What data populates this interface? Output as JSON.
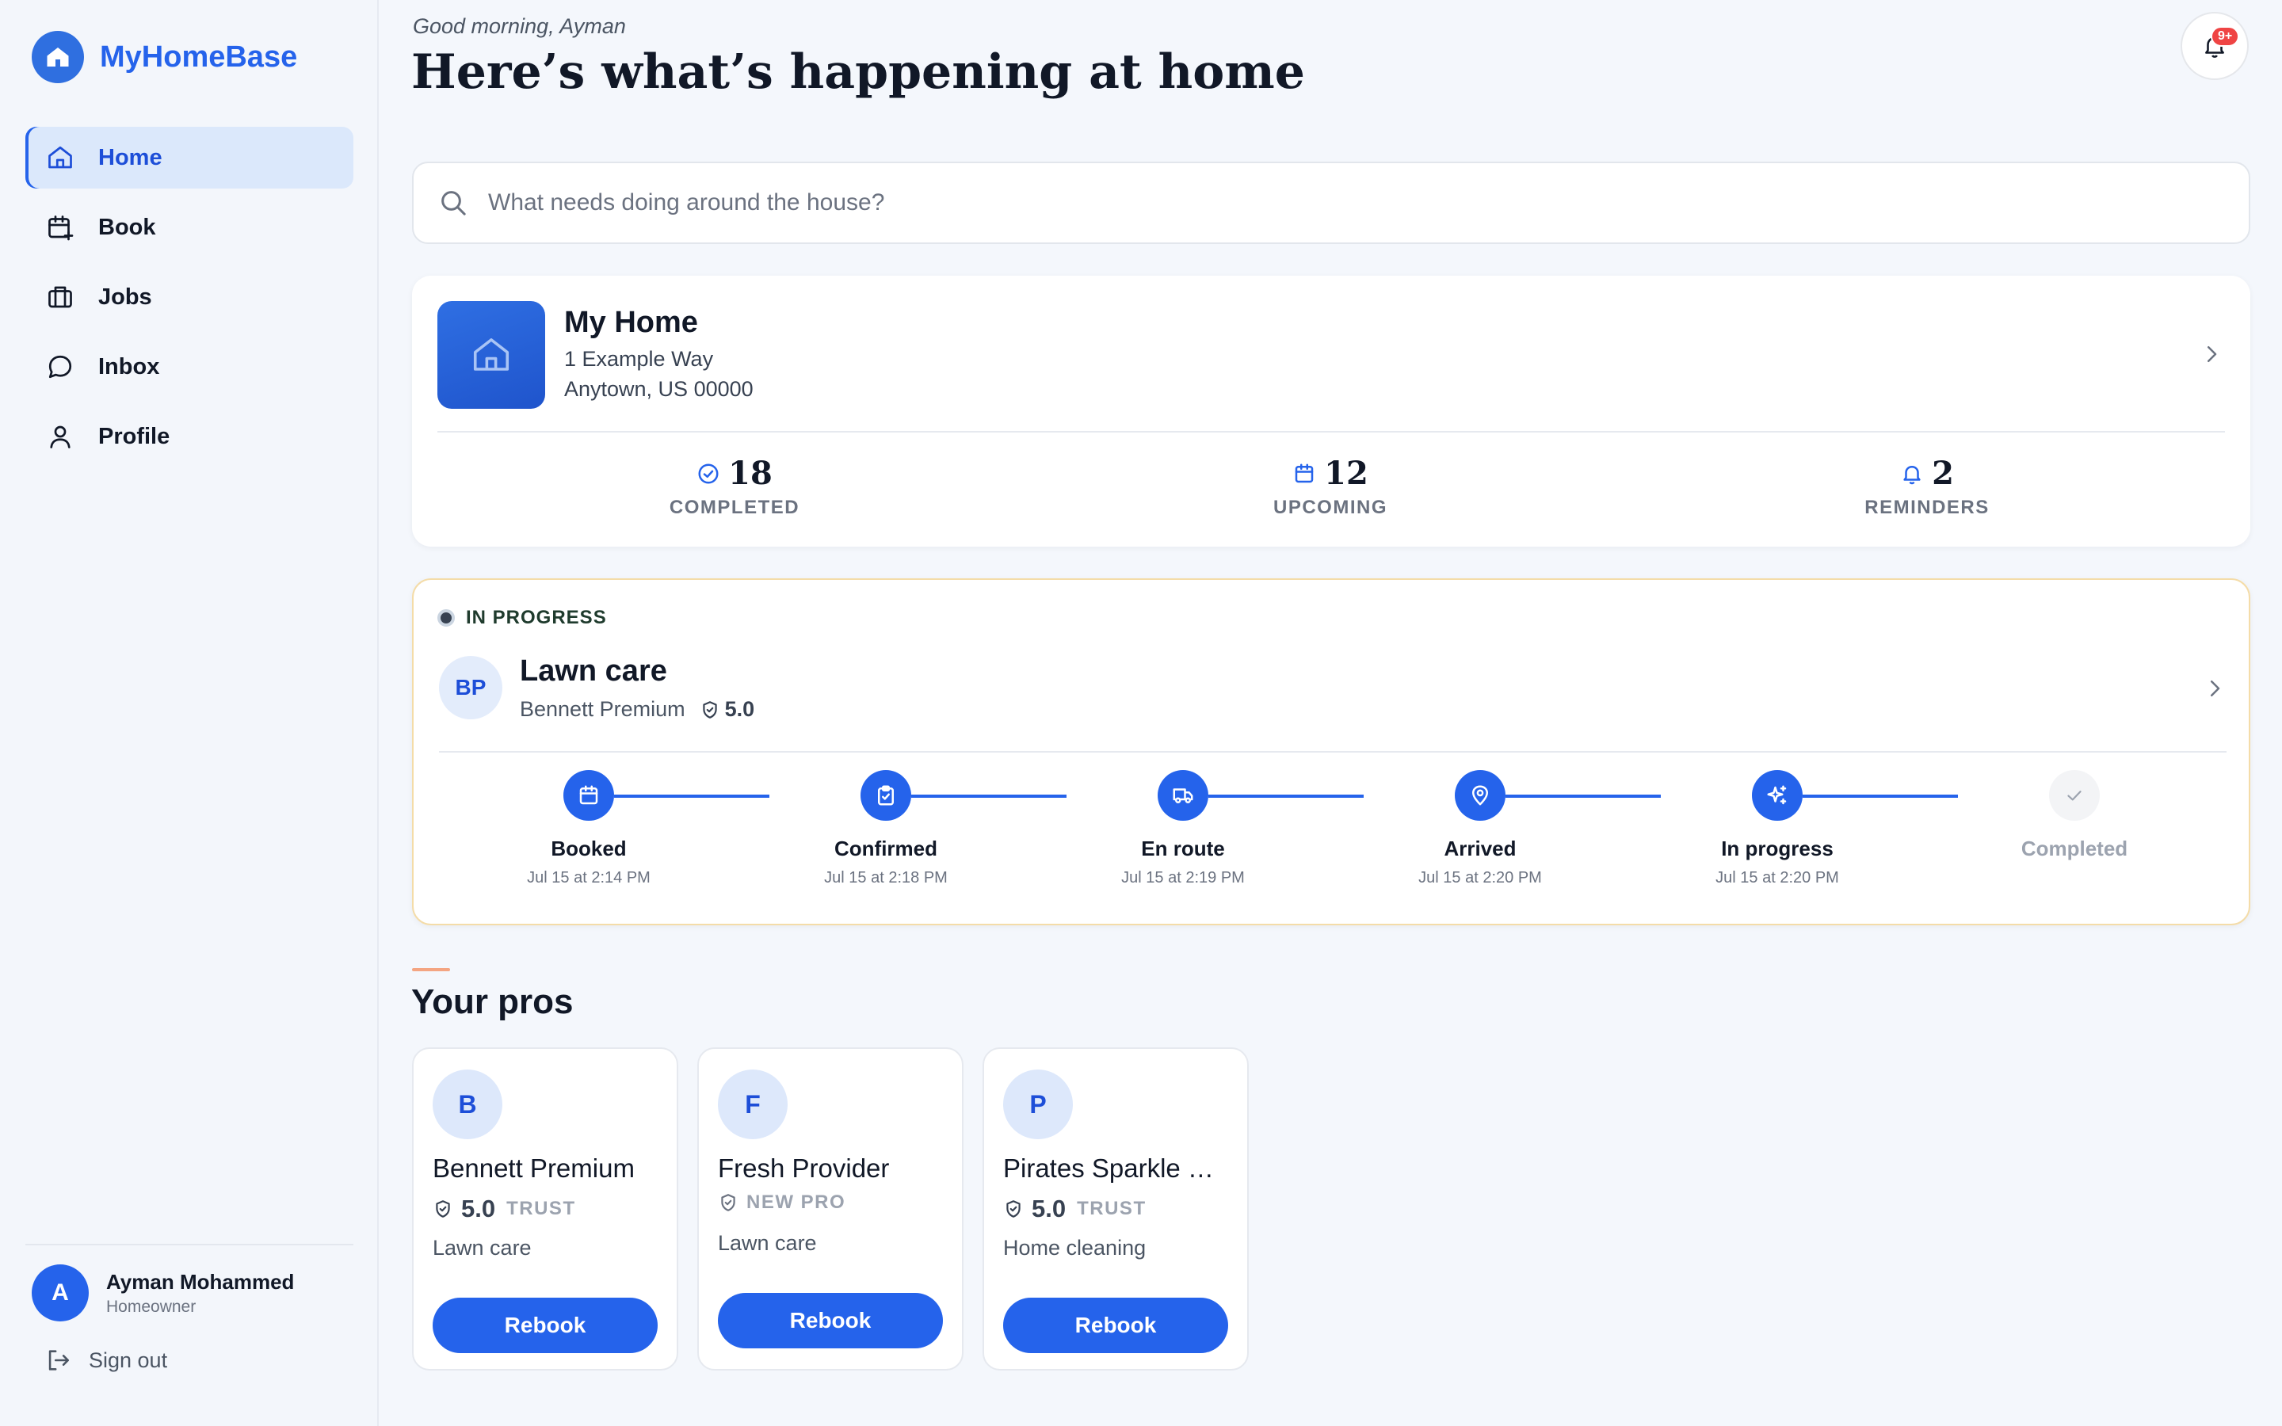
{
  "app": {
    "name": "MyHomeBase"
  },
  "nav": {
    "items": [
      {
        "label": "Home",
        "icon": "home-icon",
        "active": true
      },
      {
        "label": "Book",
        "icon": "calendar-plus-icon"
      },
      {
        "label": "Jobs",
        "icon": "briefcase-icon"
      },
      {
        "label": "Inbox",
        "icon": "chat-bubble-icon"
      },
      {
        "label": "Profile",
        "icon": "user-icon"
      }
    ]
  },
  "user": {
    "initial": "A",
    "name": "Ayman Mohammed",
    "role": "Homeowner",
    "signout_label": "Sign out"
  },
  "header": {
    "greeting": "Good morning, Ayman",
    "title": "Here’s what’s happening at home",
    "notifications_badge": "9+"
  },
  "search": {
    "placeholder": "What needs doing around the house?",
    "value": ""
  },
  "home": {
    "name": "My Home",
    "address_line1": "1 Example Way",
    "address_line2": "Anytown, US 00000",
    "stats": [
      {
        "value": "18",
        "label": "COMPLETED",
        "icon": "check-circle-icon"
      },
      {
        "value": "12",
        "label": "UPCOMING",
        "icon": "calendar-icon"
      },
      {
        "value": "2",
        "label": "REMINDERS",
        "icon": "bell-icon"
      }
    ]
  },
  "job": {
    "status": "IN PROGRESS",
    "initials": "BP",
    "title": "Lawn care",
    "provider": "Bennett Premium",
    "rating": "5.0",
    "steps": [
      {
        "label": "Booked",
        "time": "Jul 15 at 2:14 PM",
        "icon": "calendar-icon",
        "done": true
      },
      {
        "label": "Confirmed",
        "time": "Jul 15 at 2:18 PM",
        "icon": "clipboard-check-icon",
        "done": true
      },
      {
        "label": "En route",
        "time": "Jul 15 at 2:19 PM",
        "icon": "truck-icon",
        "done": true
      },
      {
        "label": "Arrived",
        "time": "Jul 15 at 2:20 PM",
        "icon": "map-pin-icon",
        "done": true
      },
      {
        "label": "In progress",
        "time": "Jul 15 at 2:20 PM",
        "icon": "sparkles-icon",
        "done": true
      },
      {
        "label": "Completed",
        "time": "",
        "icon": "check-icon",
        "done": false
      }
    ]
  },
  "pros": {
    "title": "Your pros",
    "items": [
      {
        "initial": "B",
        "name": "Bennett Premium",
        "score": "5.0",
        "badge": "TRUST",
        "service": "Lawn care",
        "button": "Rebook"
      },
      {
        "initial": "F",
        "name": "Fresh Provider",
        "score": "",
        "badge": "NEW PRO",
        "service": "Lawn care",
        "button": "Rebook"
      },
      {
        "initial": "P",
        "name": "Pirates Sparkle …",
        "score": "5.0",
        "badge": "TRUST",
        "service": "Home cleaning",
        "button": "Rebook"
      }
    ]
  },
  "colors": {
    "accent": "#2563eb",
    "background": "#f4f7fc",
    "in_progress_border": "#f4dca8"
  }
}
